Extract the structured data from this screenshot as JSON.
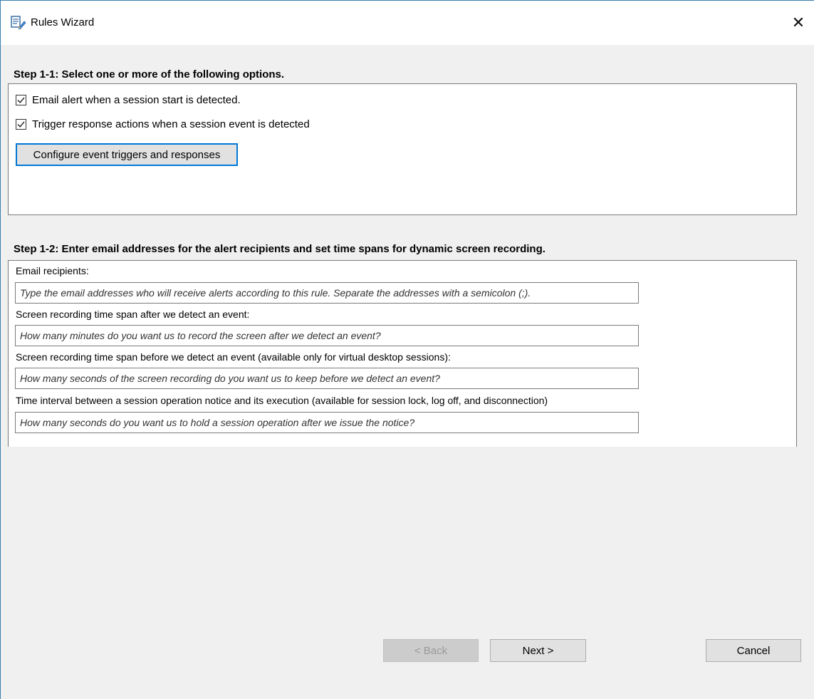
{
  "window": {
    "title": "Rules Wizard",
    "close_glyph": "✕"
  },
  "step1": {
    "heading": "Step 1-1: Select one or more of the following options.",
    "options": [
      {
        "label": "Email alert when a session start is detected.",
        "checked": true
      },
      {
        "label": "Trigger response actions when a session event is detected",
        "checked": true
      }
    ],
    "configure_button": "Configure event triggers and responses"
  },
  "step2": {
    "heading": "Step 1-2: Enter email addresses for the alert recipients and set time spans for dynamic screen recording.",
    "fields": [
      {
        "label": "Email recipients:",
        "placeholder": "Type the email addresses who will receive alerts according to this rule. Separate the addresses with a semicolon (;)."
      },
      {
        "label": "Screen recording time span after we detect an event:",
        "placeholder": "How many minutes do you want us to record the screen after we detect an event?"
      },
      {
        "label": "Screen recording time span before we detect an event (available only for virtual desktop sessions):",
        "placeholder": "How many seconds of the screen recording do you want us to keep before we detect an event?"
      },
      {
        "label": "Time interval between a session operation notice and its execution (available for session lock, log off, and disconnection)",
        "placeholder": "How many seconds do you want us to hold a session operation after we issue the notice?"
      }
    ]
  },
  "footer": {
    "back_label": "< Back",
    "next_label": "Next >",
    "cancel_label": "Cancel"
  },
  "colors": {
    "accent": "#0078d7",
    "window_bg": "#f0f0f0",
    "panel_bg": "#ffffff"
  }
}
